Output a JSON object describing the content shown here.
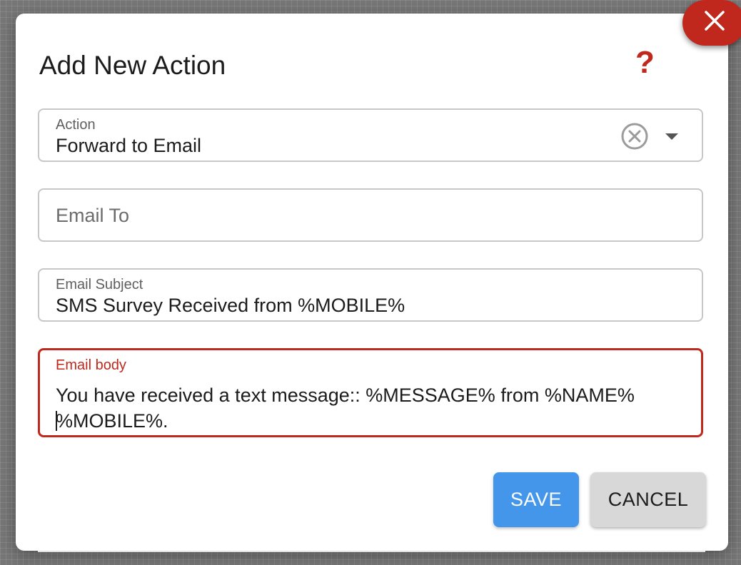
{
  "dialog": {
    "title": "Add New Action",
    "help_label": "?",
    "close_icon": "close-icon"
  },
  "fields": {
    "action": {
      "label": "Action",
      "value": "Forward to Email",
      "clear_icon": "clear-circle-icon",
      "dropdown_icon": "caret-down-icon"
    },
    "email_to": {
      "placeholder": "Email To",
      "value": ""
    },
    "email_subject": {
      "label": "Email Subject",
      "value": "SMS Survey Received from %MOBILE%"
    },
    "email_body": {
      "label": "Email body",
      "line1": "You have received a text message:: %MESSAGE% from %NAME%",
      "line2": "%MOBILE%."
    }
  },
  "buttons": {
    "save_label": "SAVE",
    "cancel_label": "CANCEL"
  },
  "colors": {
    "accent_red": "#c0281e",
    "save_blue": "#4496ea",
    "cancel_gray": "#d8d8d8"
  }
}
